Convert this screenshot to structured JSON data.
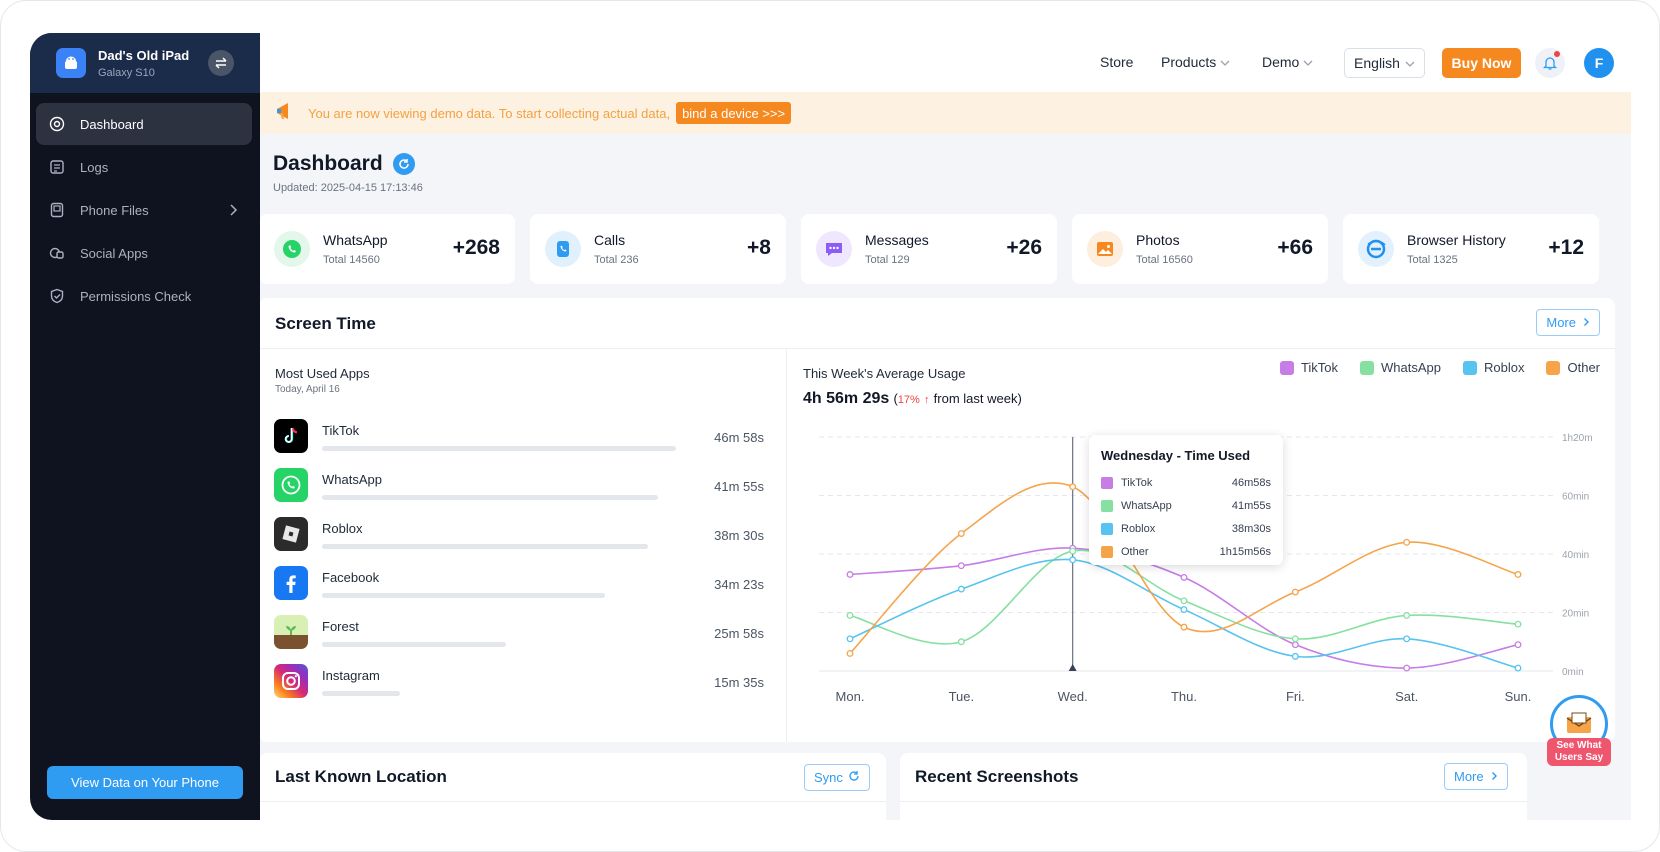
{
  "device": {
    "name": "Dad's Old iPad",
    "model": "Galaxy S10"
  },
  "sidebar": {
    "items": [
      {
        "label": "Dashboard",
        "icon": "dashboard-icon",
        "active": true
      },
      {
        "label": "Logs",
        "icon": "logs-icon"
      },
      {
        "label": "Phone Files",
        "icon": "phone-files-icon"
      },
      {
        "label": "Social Apps",
        "icon": "social-apps-icon"
      },
      {
        "label": "Permissions Check",
        "icon": "shield-check-icon"
      }
    ],
    "cta": "View Data on Your Phone"
  },
  "header": {
    "nav": [
      "Store",
      "Products",
      "Demo"
    ],
    "language": "English",
    "buy": "Buy Now",
    "avatar_initial": "F"
  },
  "banner": {
    "text": "You are now viewing demo data. To start collecting actual data,",
    "button": "bind a device >>>"
  },
  "page": {
    "title": "Dashboard",
    "updated": "Updated: 2025-04-15 17:13:46"
  },
  "stats": [
    {
      "name": "WhatsApp",
      "total": "Total 14560",
      "delta": "+268",
      "color": "#25d366"
    },
    {
      "name": "Calls",
      "total": "Total 236",
      "delta": "+8",
      "color": "#2f9bf1"
    },
    {
      "name": "Messages",
      "total": "Total 129",
      "delta": "+26",
      "color": "#8b5cf6"
    },
    {
      "name": "Photos",
      "total": "Total 16560",
      "delta": "+66",
      "color": "#f5891f"
    },
    {
      "name": "Browser History",
      "total": "Total 1325",
      "delta": "+12",
      "color": "#2191f0"
    }
  ],
  "screen_time": {
    "title": "Screen Time",
    "more": "More",
    "most_used": {
      "title": "Most Used Apps",
      "date": "Today, April 16",
      "apps": [
        {
          "name": "TikTok",
          "time": "46m 58s",
          "progress": 1.0
        },
        {
          "name": "WhatsApp",
          "time": "41m 55s",
          "progress": 0.95
        },
        {
          "name": "Roblox",
          "time": "38m 30s",
          "progress": 0.92
        },
        {
          "name": "Facebook",
          "time": "34m 23s",
          "progress": 0.8
        },
        {
          "name": "Forest",
          "time": "25m 58s",
          "progress": 0.52
        },
        {
          "name": "Instagram",
          "time": "15m 35s",
          "progress": 0.22
        }
      ]
    },
    "usage": {
      "title": "This Week's Average Usage",
      "total": "4h 56m 29s",
      "change": "17%",
      "change_arrow": "↑",
      "change_suffix": "from last week)",
      "open_paren": "("
    }
  },
  "chart_data": {
    "type": "line",
    "categories": [
      "Mon.",
      "Tue.",
      "Wed.",
      "Thu.",
      "Fri.",
      "Sat.",
      "Sun."
    ],
    "y_ticks": [
      "0min",
      "20min",
      "40min",
      "60min",
      "1h20m"
    ],
    "ylim": [
      0,
      80
    ],
    "grid": true,
    "legend_position": "top-right",
    "series": [
      {
        "name": "TikTok",
        "color": "#c77ce6",
        "values": [
          33,
          36,
          42,
          32,
          9,
          1,
          9
        ]
      },
      {
        "name": "WhatsApp",
        "color": "#86e0a0",
        "values": [
          19,
          10,
          41,
          24,
          11,
          19,
          16
        ]
      },
      {
        "name": "Roblox",
        "color": "#56c3f0",
        "values": [
          11,
          28,
          38,
          21,
          5,
          11,
          1
        ]
      },
      {
        "name": "Other",
        "color": "#f5a44a",
        "values": [
          6,
          47,
          63,
          15,
          27,
          44,
          33
        ]
      }
    ],
    "tooltip": {
      "title": "Wednesday - Time Used",
      "rows": [
        {
          "name": "TikTok",
          "value": "46m58s",
          "color": "#c77ce6"
        },
        {
          "name": "WhatsApp",
          "value": "41m55s",
          "color": "#86e0a0"
        },
        {
          "name": "Roblox",
          "value": "38m30s",
          "color": "#56c3f0"
        },
        {
          "name": "Other",
          "value": "1h15m56s",
          "color": "#f5a44a"
        }
      ]
    }
  },
  "location": {
    "title": "Last Known Location",
    "sync": "Sync"
  },
  "screenshots": {
    "title": "Recent Screenshots",
    "more": "More"
  },
  "float_badge": {
    "label": "See What Users Say"
  }
}
